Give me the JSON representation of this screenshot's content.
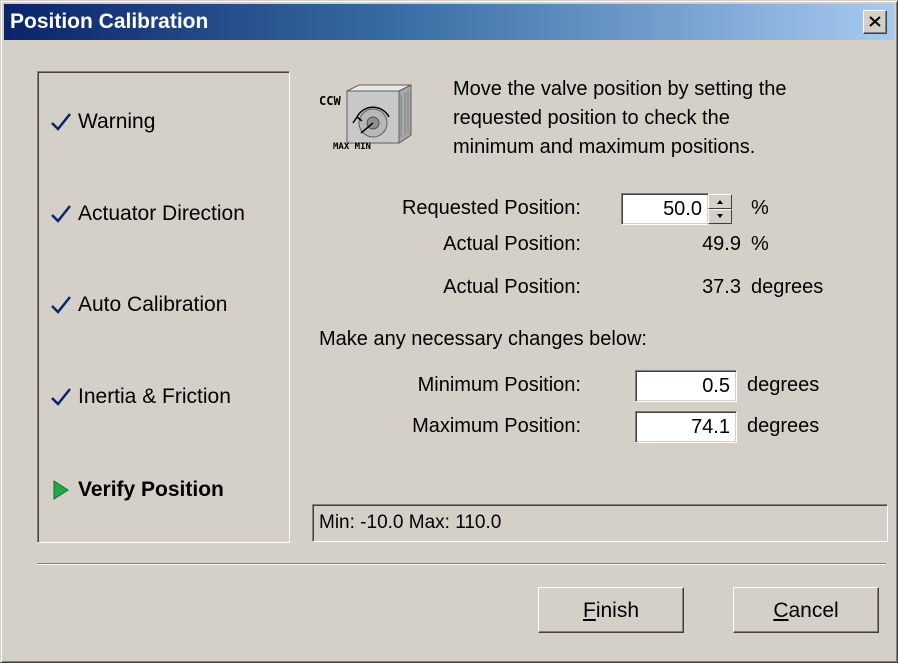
{
  "window": {
    "title": "Position Calibration",
    "colors": {
      "title_start": "#0a246a",
      "title_end": "#a6caf0",
      "background": "#d4d0c8",
      "check": "#0a246a",
      "arrow": "#22a84a"
    }
  },
  "steps": [
    {
      "label": "Warning",
      "state": "done",
      "icon": "checkmark-icon"
    },
    {
      "label": "Actuator Direction",
      "state": "done",
      "icon": "checkmark-icon"
    },
    {
      "label": "Auto Calibration",
      "state": "done",
      "icon": "checkmark-icon"
    },
    {
      "label": "Inertia & Friction",
      "state": "done",
      "icon": "checkmark-icon"
    },
    {
      "label": "Verify Position",
      "state": "current",
      "icon": "play-arrow-icon"
    }
  ],
  "valve_icon": {
    "icon": "valve-rotation-icon",
    "top_text": "CCW",
    "bottom_text": "MAX MIN"
  },
  "instructions": {
    "line1": "Move the valve position by setting the",
    "line2": "requested position to check the",
    "line3": "minimum and maximum positions."
  },
  "requested": {
    "label": "Requested Position:",
    "value": "50.0",
    "unit": "%"
  },
  "actual_pct": {
    "label": "Actual Position:",
    "value": "49.9",
    "unit": "%"
  },
  "actual_deg": {
    "label": "Actual Position:",
    "value": "37.3",
    "unit": "degrees"
  },
  "changes_heading": "Make any necessary changes below:",
  "min_position": {
    "label": "Minimum Position:",
    "value": "0.5",
    "unit": "degrees"
  },
  "max_position": {
    "label": "Maximum Position:",
    "value": "74.1",
    "unit": "degrees"
  },
  "range_text": "Min: -10.0 Max: 110.0",
  "buttons": {
    "finish": {
      "accel": "F",
      "rest": "inish"
    },
    "cancel": {
      "accel": "C",
      "rest": "ancel"
    }
  }
}
